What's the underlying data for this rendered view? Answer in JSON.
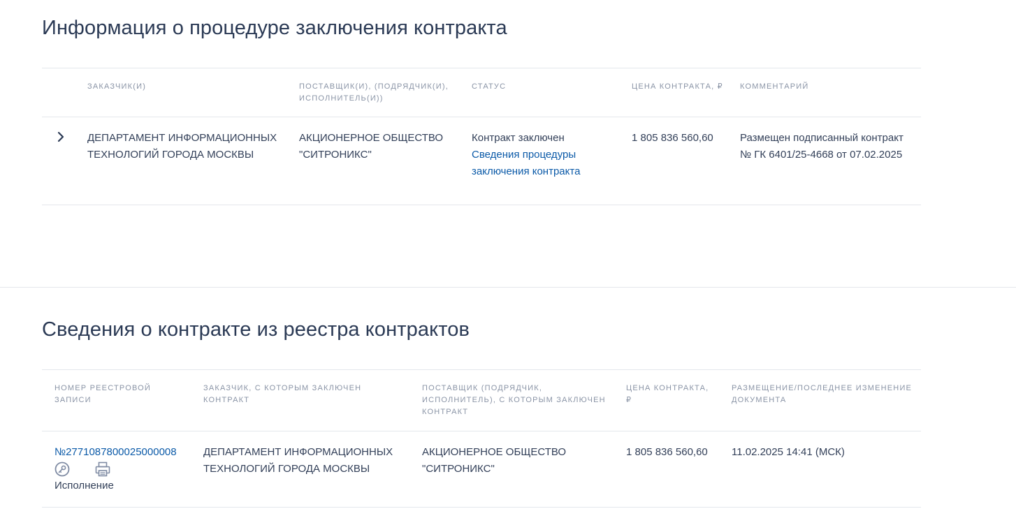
{
  "procedure": {
    "title": "Информация о процедуре заключения контракта",
    "headers": {
      "customer": "ЗАКАЗЧИК(И)",
      "supplier": "ПОСТАВЩИК(И), (ПОДРЯДЧИК(И), ИСПОЛНИТЕЛЬ(И))",
      "status": "СТАТУС",
      "price": "ЦЕНА КОНТРАКТА, ₽",
      "comment": "КОММЕНТАРИЙ"
    },
    "row": {
      "customer": "ДЕПАРТАМЕНТ ИНФОРМАЦИОННЫХ ТЕХНОЛОГИЙ ГОРОДА МОСКВЫ",
      "supplier": "АКЦИОНЕРНОЕ ОБЩЕСТВО \"СИТРОНИКС\"",
      "status_text": "Контракт заключен",
      "status_link": "Сведения процедуры заключения контракта",
      "price": "1 805 836 560,60",
      "comment": "Размещен подписанный контракт № ГК 6401/25-4668 от 07.02.2025"
    }
  },
  "registry": {
    "title": "Сведения о контракте из реестра контрактов",
    "headers": {
      "number": "НОМЕР РЕЕСТРОВОЙ ЗАПИСИ",
      "customer": "ЗАКАЗЧИК, С КОТОРЫМ ЗАКЛЮЧЕН КОНТРАКТ",
      "supplier": "ПОСТАВЩИК (ПОДРЯДЧИК, ИСПОЛНИТЕЛЬ), С КОТОРЫМ ЗАКЛЮЧЕН КОНТРАКТ",
      "price": "ЦЕНА КОНТРАКТА, ₽",
      "placement": "РАЗМЕЩЕНИЕ/ПОСЛЕДНЕЕ ИЗМЕНЕНИЕ ДОКУМЕНТА"
    },
    "row": {
      "number": "№2771087800025000008",
      "status_label": "Исполнение",
      "customer": "ДЕПАРТАМЕНТ ИНФОРМАЦИОННЫХ ТЕХНОЛОГИЙ ГОРОДА МОСКВЫ",
      "supplier": "АКЦИОНЕРНОЕ ОБЩЕСТВО \"СИТРОНИКС\"",
      "price": "1 805 836 560,60",
      "placement": "11.02.2025 14:41 (МСК)"
    },
    "icons": [
      "key-icon",
      "print-icon"
    ]
  },
  "colors": {
    "title": "#2b3a55",
    "text": "#334059",
    "header": "#8a94a6",
    "link": "#0b5aa8",
    "divider": "#e4e7ec",
    "icon": "#7f8ba3"
  }
}
